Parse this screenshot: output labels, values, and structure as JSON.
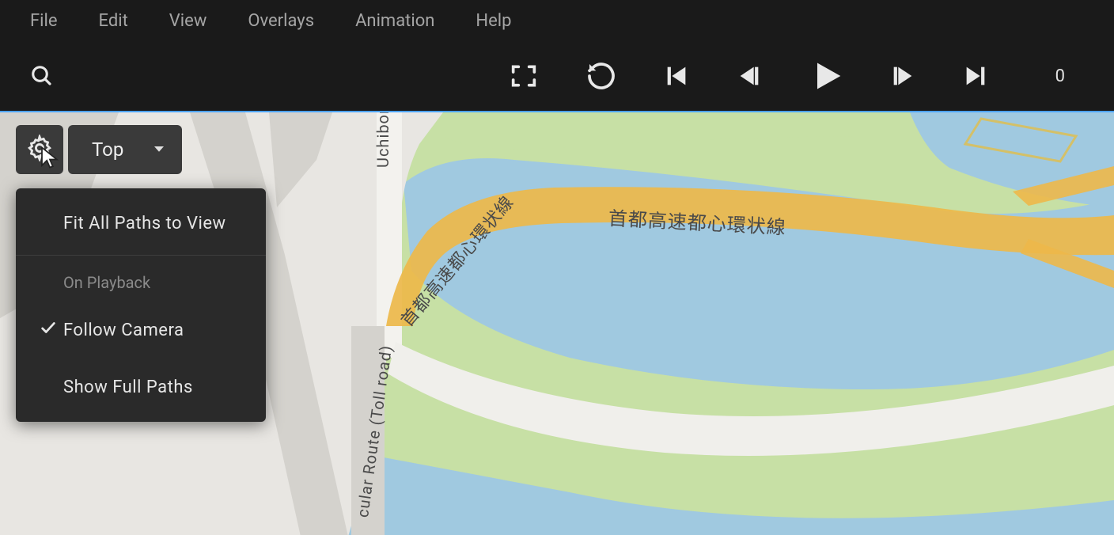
{
  "menubar": {
    "items": [
      "File",
      "Edit",
      "View",
      "Overlays",
      "Animation",
      "Help"
    ]
  },
  "toolbar": {
    "frame_counter": "0"
  },
  "view_controls": {
    "selected_view": "Top"
  },
  "settings_menu": {
    "fit_paths_label": "Fit All Paths to View",
    "section_label": "On Playback",
    "follow_camera_label": "Follow Camera",
    "show_full_paths_label": "Show Full Paths",
    "follow_camera_checked": true,
    "show_full_paths_checked": false
  },
  "map": {
    "road_labels": {
      "vertical_street": "Uchibori Dori",
      "highway_left_segment": "首都高速都心環状線",
      "highway_right_segment": "首都高速都心環状線",
      "highway_vertical_segment": "cular Route (Toll road)"
    }
  }
}
